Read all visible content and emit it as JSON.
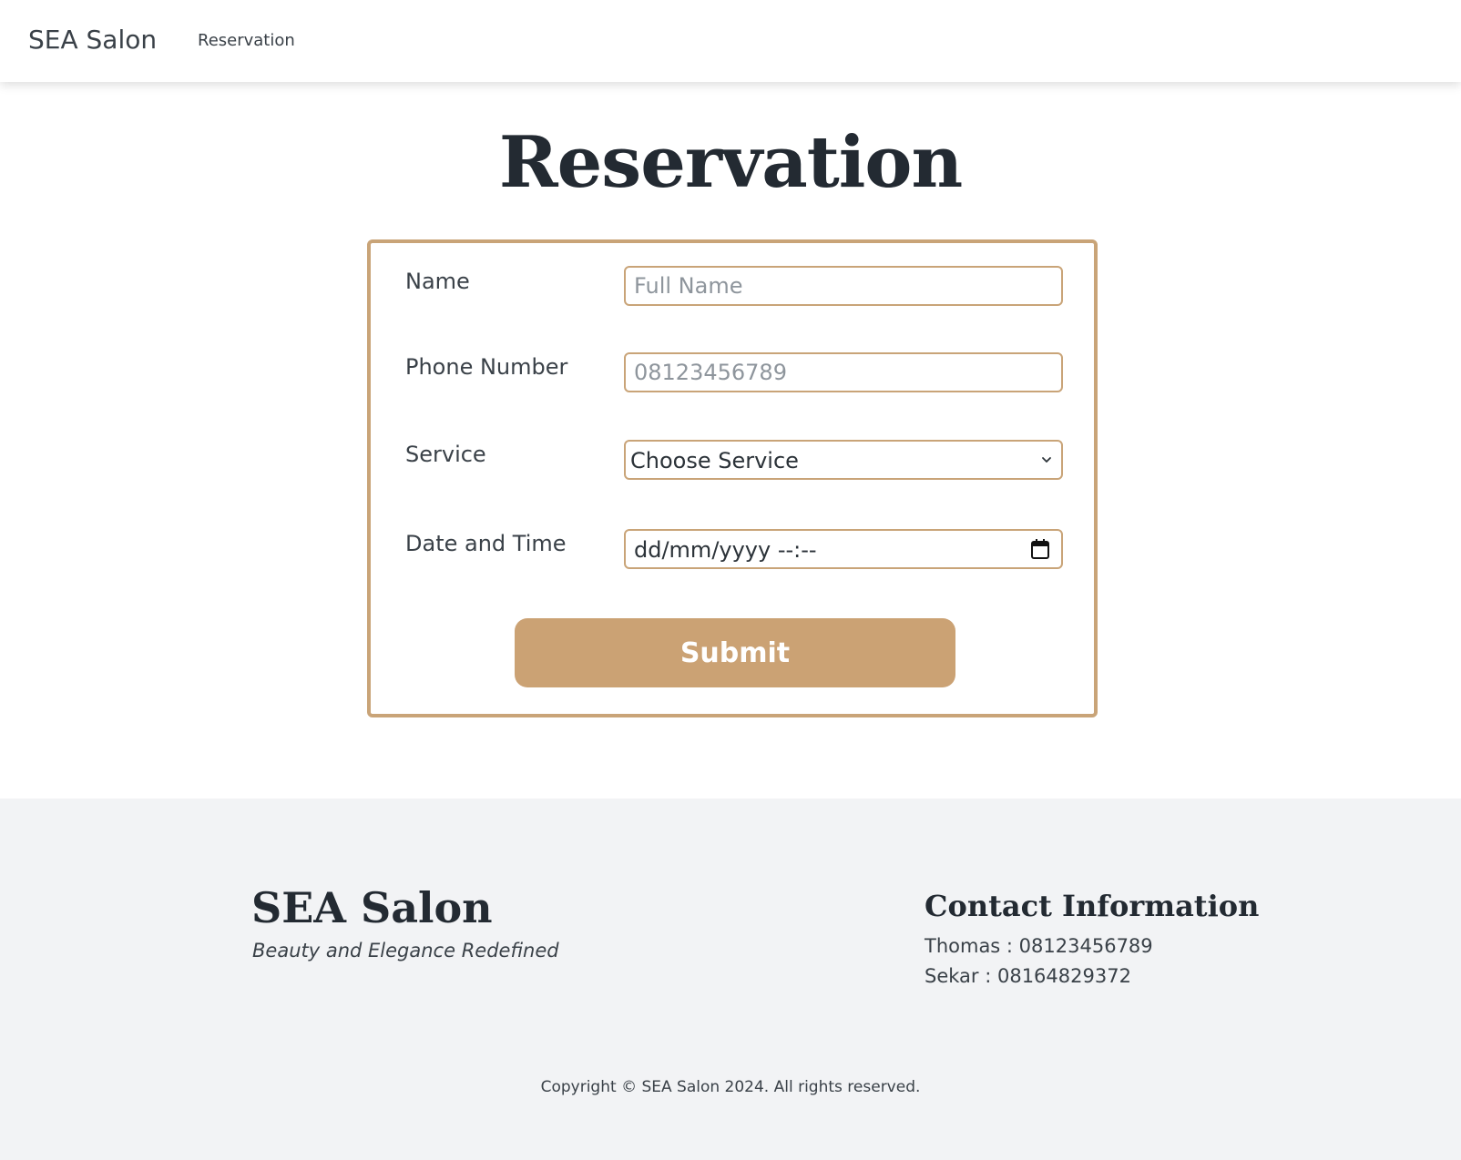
{
  "navbar": {
    "brand": "SEA Salon",
    "links": [
      "Reservation"
    ]
  },
  "main": {
    "title": "Reservation",
    "form": {
      "name": {
        "label": "Name",
        "placeholder": "Full Name",
        "value": ""
      },
      "phone": {
        "label": "Phone Number",
        "placeholder": "08123456789",
        "value": ""
      },
      "service": {
        "label": "Service",
        "selected": "Choose Service",
        "icon": "chevron-down-icon"
      },
      "datetime": {
        "label": "Date and Time",
        "value": "dd/mm/yyyy --:--",
        "icon": "calendar-icon"
      },
      "submit_label": "Submit"
    }
  },
  "footer": {
    "brand": "SEA Salon",
    "tagline": "Beauty and Elegance Redefined",
    "contact": {
      "title": "Contact Information",
      "lines": [
        "Thomas : 08123456789",
        "Sekar : 08164829372"
      ]
    },
    "copyright": "Copyright © SEA Salon 2024. All rights reserved."
  },
  "colors": {
    "accent": "#c9a478",
    "button": "#cba274",
    "footer_bg": "#f2f3f5",
    "text_dark": "#232a32"
  }
}
